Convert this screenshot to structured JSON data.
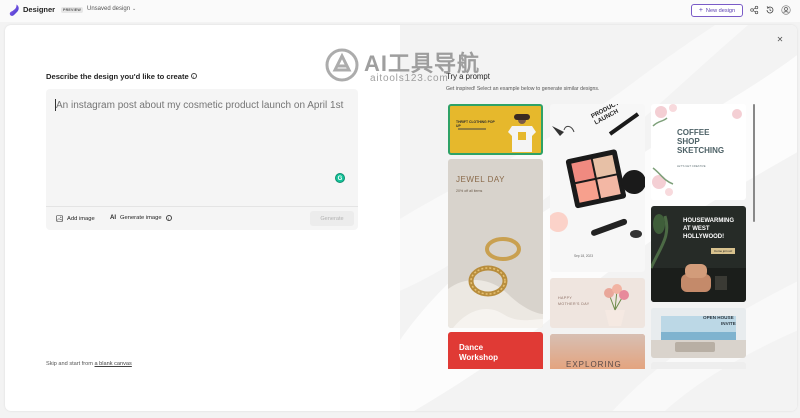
{
  "app": {
    "title": "Designer",
    "badge": "PREVIEW",
    "document_name": "Unsaved design",
    "new_design_label": "New design",
    "accent_color": "#5b3fb0"
  },
  "watermark": {
    "title": "AI工具导航",
    "subtitle": "aitools123.com"
  },
  "left": {
    "describe_label": "Describe the design you'd like to create",
    "prompt_placeholder": "An instagram post about my cosmetic product launch on April 1st",
    "add_image_label": "Add image",
    "generate_image_label": "Generate image",
    "ai_glyph": "AI",
    "generate_button_label": "Generate",
    "skip_prefix": "Skip and start from",
    "skip_link": "a blank canvas",
    "grammarly_glyph": "G"
  },
  "right": {
    "title": "Try a prompt",
    "subtitle": "Get inspired! Select an example below to generate similar designs.",
    "cards": {
      "thrift": {
        "title": "THRIFT CLOTHING POP UP"
      },
      "product_launch": {
        "title": "PRODUCT LAUNCH",
        "date": "Sep 18, 2023"
      },
      "coffee": {
        "line1": "COFFEE",
        "line2": "SHOP",
        "line3": "SKETCHING",
        "sub": "LET'S GET CREATIVE"
      },
      "jewel": {
        "title": "JEWEL DAY",
        "sub": "20% off all items"
      },
      "housewarming": {
        "line1": "HOUSEWARMING",
        "line2": "AT WEST",
        "line3": "HOLLYWOOD!",
        "tag": "Come join us!"
      },
      "mothers": {
        "line1": "HAPPY",
        "line2": "MOTHER'S DAY"
      },
      "open_house": {
        "line1": "OPEN HOUSE",
        "line2": "INVITE"
      },
      "dance": {
        "line1": "Dance",
        "line2": "Workshop"
      },
      "exploring": {
        "title": "EXPLORING"
      }
    }
  }
}
